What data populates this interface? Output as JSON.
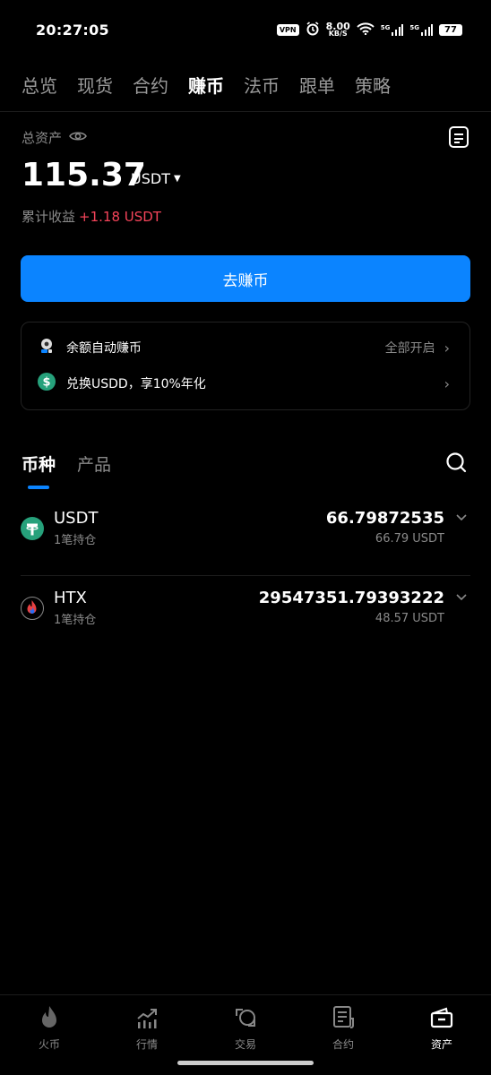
{
  "status_bar": {
    "time": "20:27:05",
    "vpn": "VPN",
    "speed_value": "8.00",
    "speed_unit": "KB/S",
    "signal1": "5G",
    "signal2": "5G",
    "battery": "77"
  },
  "top_nav": {
    "tabs": [
      "总览",
      "现货",
      "合约",
      "赚币",
      "法币",
      "跟单",
      "策略"
    ],
    "active_index": 3
  },
  "assets": {
    "label": "总资产",
    "total": "115.37",
    "unit": "USDT",
    "earnings_label": "累计收益",
    "earnings_value": "+1.18 USDT"
  },
  "cta_button": "去赚币",
  "promo_card": {
    "rows": [
      {
        "icon": "auto-earn-icon",
        "label": "余额自动赚币",
        "right": "全部开启"
      },
      {
        "icon": "usdd-icon",
        "label": "兑换USDD，享10%年化",
        "right": ""
      }
    ]
  },
  "sub_tabs": {
    "tabs": [
      "币种",
      "产品"
    ],
    "active_index": 0
  },
  "coins": [
    {
      "icon": "usdt-icon",
      "name": "USDT",
      "positions": "1笔持仓",
      "amount": "66.79872535",
      "value": "66.79 USDT"
    },
    {
      "icon": "htx-icon",
      "name": "HTX",
      "positions": "1笔持仓",
      "amount": "29547351.79393222",
      "value": "48.57 USDT"
    }
  ],
  "bottom_nav": {
    "items": [
      "火币",
      "行情",
      "交易",
      "合约",
      "资产"
    ],
    "active_index": 4
  },
  "colors": {
    "accent": "#0b84ff",
    "positive": "#f5445a",
    "usdt": "#26a17b",
    "background": "#000000"
  }
}
